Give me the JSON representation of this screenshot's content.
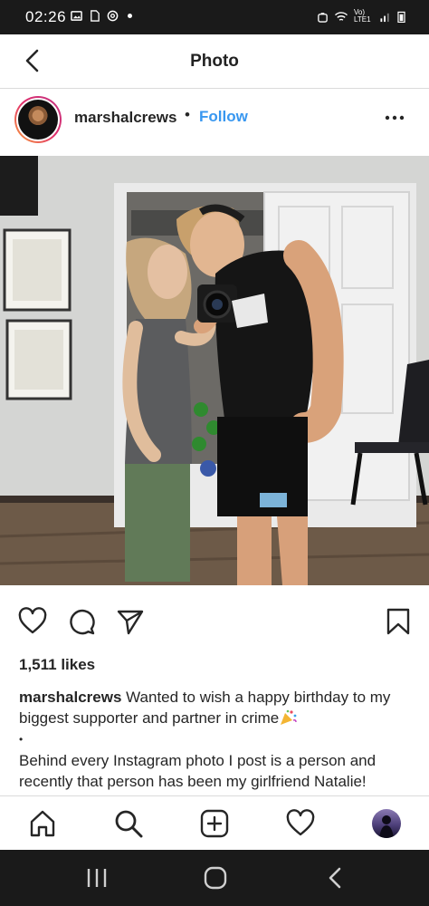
{
  "status_bar": {
    "time": "02:26",
    "network_label": "Vo) LTE1"
  },
  "header": {
    "title": "Photo"
  },
  "post": {
    "username": "marshalcrews",
    "separator": "•",
    "follow_label": "Follow",
    "likes": "1,511 likes",
    "caption_username": "marshalcrews",
    "caption_line1": " Wanted to wish a happy birthday to my biggest supporter and partner in crime",
    "caption_bullet": "•",
    "caption_line2": "Behind every Instagram photo I post is a person and recently that person has been my girlfriend Natalie!"
  },
  "icons": {
    "back": "back-arrow-icon",
    "more": "more-options-icon",
    "like": "heart-icon",
    "comment": "comment-icon",
    "share": "send-icon",
    "save": "bookmark-icon",
    "home": "home-icon",
    "search": "search-icon",
    "new_post": "add-post-icon",
    "activity": "heart-icon",
    "recents": "recent-apps-icon",
    "home_sys": "system-home-icon",
    "back_sys": "system-back-icon"
  },
  "colors": {
    "follow_blue": "#3897f0",
    "status_bar_bg": "#1a1a1a"
  }
}
